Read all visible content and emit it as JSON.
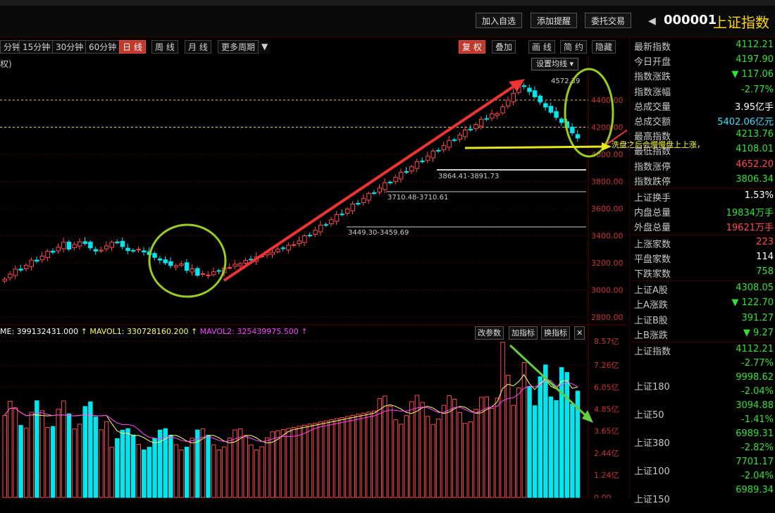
{
  "topbar": {
    "buttons": [
      "加入自选",
      "添加提醒",
      "委托交易"
    ],
    "code": "000001",
    "name": "上证指数"
  },
  "periods": [
    "分钟",
    "15分钟",
    "30分钟",
    "60分钟",
    "日 线",
    "周 线",
    "月 线",
    "更多周期"
  ],
  "tools": [
    "复 权",
    "叠加",
    "画 线",
    "简 约",
    "隐藏"
  ],
  "fuquan_label": "权)",
  "set_ma_label": "设置均线",
  "price_axis": [
    "4400.00",
    "4200.00",
    "4000.00",
    "3800.00",
    "3600.00",
    "3400.00",
    "3200.00",
    "3000.00",
    "2800.00"
  ],
  "price_annotations": [
    "4572.39",
    "3864.41-3891.73",
    "3710.48-3710.61",
    "3449.30-3459.69"
  ],
  "annotation_text": "洗盘之后会慢慢盘上上涨，",
  "volume": {
    "legend_vol": "ME: 399132431.000",
    "legend_mavol1": "MAVOL1: 330728160.200",
    "legend_mavol2": "MAVOL2: 325439975.500",
    "buttons": [
      "改参数",
      "加指标",
      "换指标"
    ],
    "axis": [
      "8.57亿",
      "7.26亿",
      "6.05亿",
      "4.85亿",
      "3.65亿",
      "2.44亿",
      "1.24亿",
      "0.00"
    ]
  },
  "quote": {
    "section1": [
      {
        "label": "最新指数",
        "value": "4112.21",
        "color": "down"
      },
      {
        "label": "今日开盘",
        "value": "4197.90",
        "color": "down"
      },
      {
        "label": "指数涨跌",
        "value": "▼ 117.06",
        "color": "down"
      },
      {
        "label": "指数涨幅",
        "value": "-2.77%",
        "color": "down"
      },
      {
        "label": "总成交量",
        "value": "3.95亿手",
        "color": "white"
      },
      {
        "label": "总成交额",
        "value": "5402.06亿元",
        "color": "cyan"
      },
      {
        "label": "最高指数",
        "value": "4213.76",
        "color": "down"
      },
      {
        "label": "最低指数",
        "value": "4108.01",
        "color": "down"
      },
      {
        "label": "指数涨停",
        "value": "4652.20",
        "color": "up"
      },
      {
        "label": "指数跌停",
        "value": "3806.34",
        "color": "down"
      }
    ],
    "section2": [
      {
        "label": "上证换手",
        "value": "1.53%",
        "color": "white"
      },
      {
        "label": "内盘总量",
        "value": "19834万手",
        "color": "down"
      },
      {
        "label": "外盘总量",
        "value": "19621万手",
        "color": "up"
      }
    ],
    "section3": [
      {
        "label": "上涨家数",
        "value": "223",
        "color": "up"
      },
      {
        "label": "平盘家数",
        "value": "114",
        "color": "white"
      },
      {
        "label": "下跌家数",
        "value": "758",
        "color": "down"
      }
    ],
    "section4": [
      {
        "label": "上证A股",
        "value": "4308.05",
        "color": "down"
      },
      {
        "label": "上A涨跌",
        "value": "▼ 122.70",
        "color": "down"
      },
      {
        "label": "上证B股",
        "value": "391.27",
        "color": "down"
      },
      {
        "label": "上B涨跌",
        "value": "▼ 9.27",
        "color": "down"
      }
    ],
    "section5": [
      {
        "label": "上证指数",
        "value": "4112.21",
        "sub": "-2.77%"
      },
      {
        "label": "上证180",
        "value": "9998.62",
        "sub": "-2.04%"
      },
      {
        "label": "上证50",
        "value": "3094.88",
        "sub": "-1.41%"
      },
      {
        "label": "上证380",
        "value": "6989.31",
        "sub": "-2.82%"
      },
      {
        "label": "上证100",
        "value": "7701.17",
        "sub": "-2.04%"
      },
      {
        "label": "上证150",
        "value": "6989.34",
        "sub": ""
      }
    ]
  },
  "colors": {
    "up": "#ff4a4a",
    "down": "#00e5ee",
    "ma1": "#ffff66",
    "ma2": "#ff44ff"
  }
}
